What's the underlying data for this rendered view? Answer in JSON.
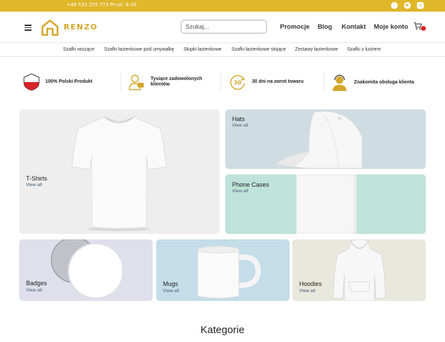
{
  "topbar": {
    "contact": "+48 532 255 773  Pn-pt. 8-18",
    "social_icons": [
      "facebook-icon",
      "youtube-icon",
      "instagram-icon"
    ]
  },
  "header": {
    "logo_text": "RENZO",
    "search_placeholder": "Szukaj...",
    "nav": [
      "Promocje",
      "Blog",
      "Kontakt",
      "Moje konto"
    ]
  },
  "categories_bar": [
    "Szafki wiszące",
    "Szafki łazienkowe pod umywalkę",
    "Słupki łazienkowe",
    "Szafki łazienkowe stojące",
    "Zestawy łazienkowe",
    "Szafki z lustrem"
  ],
  "features": [
    {
      "text": "100% Polski Produkt",
      "icon": "poland-flag-icon"
    },
    {
      "text": "Tysiące zadowolonych klientów",
      "icon": "happy-customer-icon"
    },
    {
      "text": "30 dni na zwrot towaru",
      "icon": "30-days-return-icon"
    },
    {
      "text": "Znakomita obsługa klienta",
      "icon": "customer-support-icon"
    }
  ],
  "tiles": [
    {
      "title": "T-Shirts",
      "link": "View all"
    },
    {
      "title": "Hats",
      "link": "View all"
    },
    {
      "title": "Phone Cases",
      "link": "View all"
    },
    {
      "title": "Badges",
      "link": "View all"
    },
    {
      "title": "Mugs",
      "link": "View all"
    },
    {
      "title": "Hoodies",
      "link": "View all"
    }
  ],
  "section_heading": "Kategorie",
  "colors": {
    "accent": "#e0b62a",
    "logo": "#d4a72c",
    "cart_badge": "#e02020",
    "tshirts_bg": "#eeeeee",
    "hats_bg": "#cfdde2",
    "phone_cases_bg": "#bfe3d8",
    "badges_bg": "#dfe0ec",
    "mugs_bg": "#c4dde9",
    "hoodies_bg": "#e8e8dc"
  }
}
